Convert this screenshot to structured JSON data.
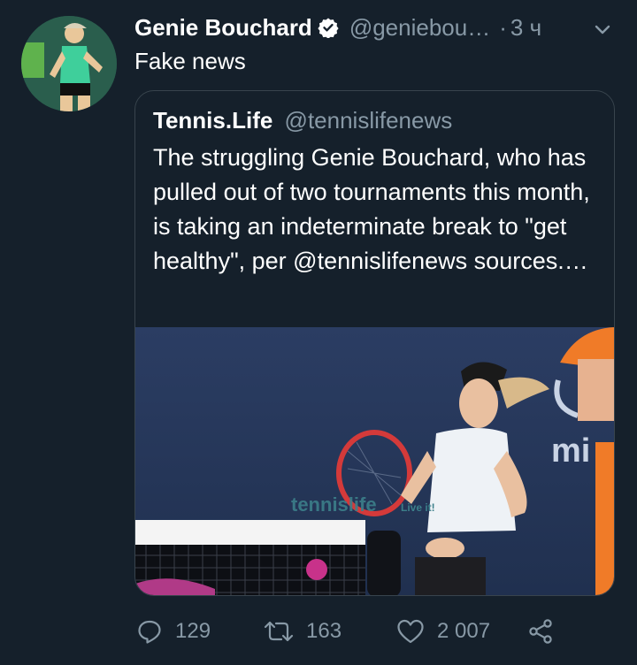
{
  "tweet": {
    "author_name": "Genie Bouchard",
    "handle": "@geniebou…",
    "separator": "·",
    "time": "3 ч",
    "text": "Fake news"
  },
  "quoted": {
    "author_name": "Tennis.Life",
    "handle": "@tennislifenews",
    "text": "The struggling Genie Bouchard, who has pulled out of two tournaments this month, is taking an indeterminate break to \"get healthy\", per @tennislifenews sources.…",
    "media_watermark_brand": "tennislife",
    "media_watermark_tag": "Live it!",
    "media_banner_text": "mi"
  },
  "actions": {
    "replies": "129",
    "retweets": "163",
    "likes": "2 007"
  },
  "colors": {
    "background": "#15202b",
    "secondary_text": "#8899a6",
    "border": "#38444d",
    "verified_badge": "#ffffff"
  },
  "icons": [
    "verified-badge-icon",
    "chevron-down-icon",
    "reply-icon",
    "retweet-icon",
    "like-icon",
    "share-icon"
  ]
}
